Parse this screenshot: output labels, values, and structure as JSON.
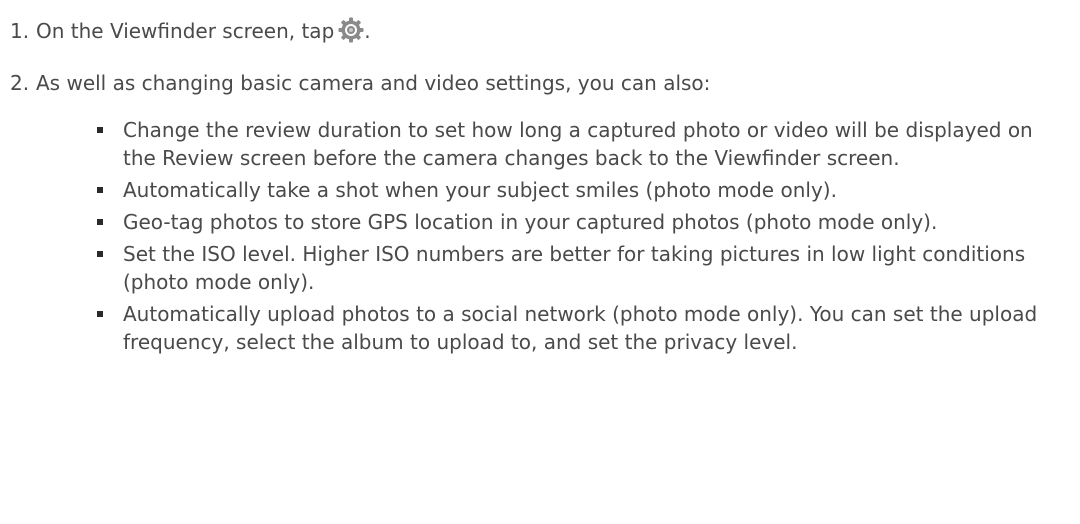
{
  "steps": [
    {
      "number": "1.",
      "text_before_icon": "On the Viewfinder screen, tap",
      "icon": "gear-icon",
      "text_after_icon": "."
    },
    {
      "number": "2.",
      "text": "As well as changing basic camera and video settings, you can also:"
    }
  ],
  "bullets": [
    "Change the review duration to set how long a captured photo or video will be displayed on the Review screen before the camera changes back to the Viewfinder screen.",
    "Automatically take a shot when your subject smiles (photo mode only).",
    "Geo-tag photos to store GPS location in your captured photos (photo mode only).",
    "Set the ISO level. Higher ISO numbers are better for taking pictures in low light conditions (photo mode only).",
    "Automatically upload photos to a social network (photo mode only). You can set the upload frequency, select the album to upload to, and set the privacy level."
  ],
  "colors": {
    "text": "#4a4a4a",
    "bullet": "#2a2a2a",
    "icon": "#8a8a8a"
  }
}
